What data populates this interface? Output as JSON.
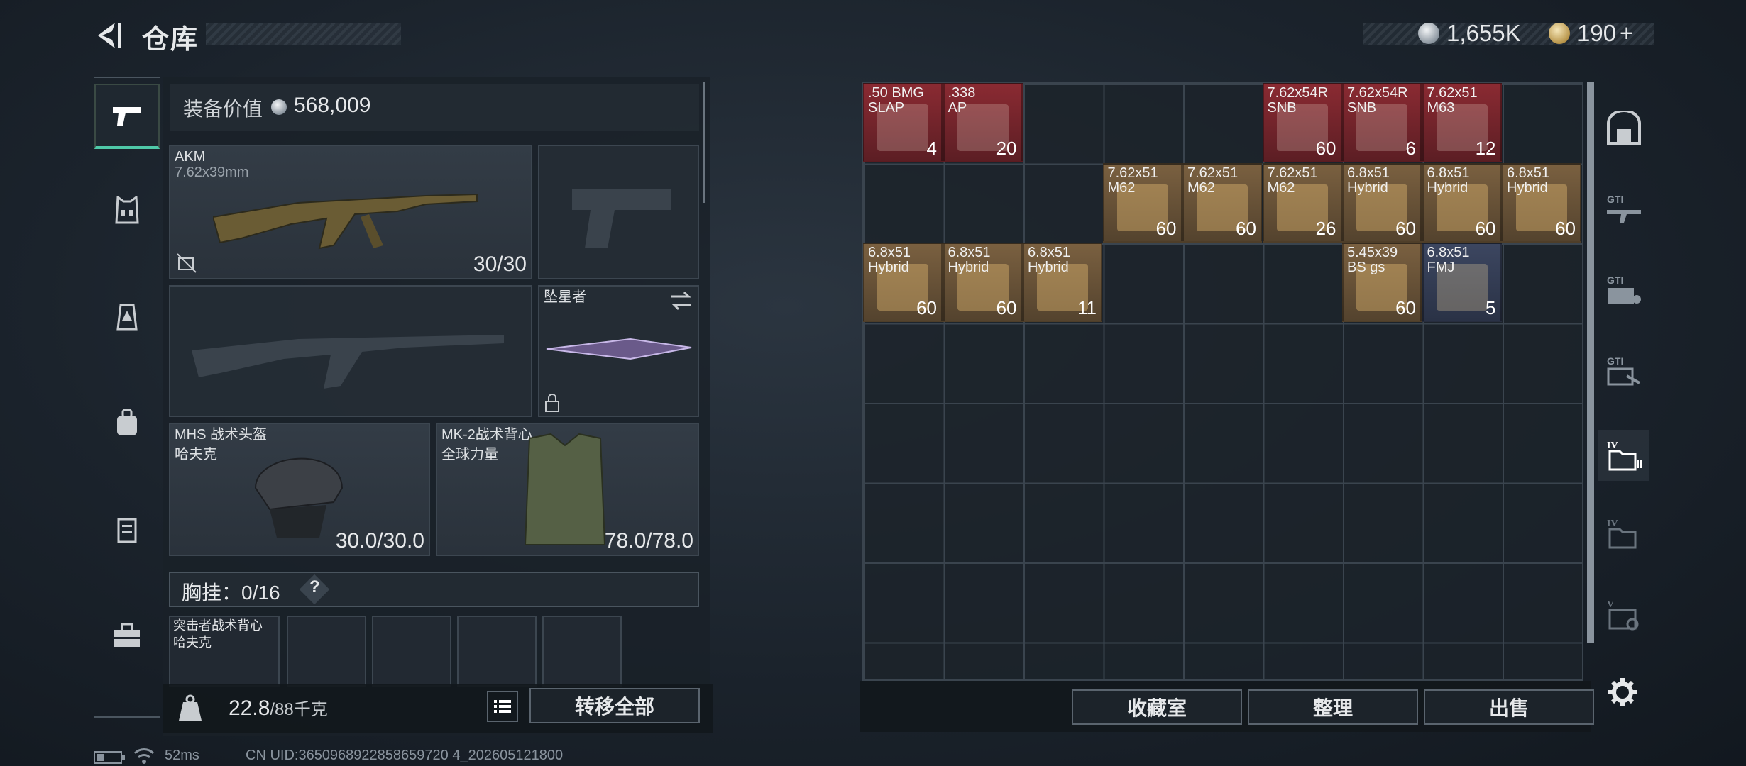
{
  "header": {
    "title": "仓库",
    "currency_silver": "1,655K",
    "currency_gold": "190",
    "gold_plus": "+"
  },
  "equipment": {
    "value_label": "装备价值",
    "value": "568,009",
    "primary": {
      "name": "AKM",
      "caliber": "7.62x39mm",
      "ammo": "30/30"
    },
    "melee": {
      "name": "坠星者"
    },
    "helmet": {
      "name": "MHS 战术头盔",
      "brand": "哈夫克",
      "durability": "30.0/30.0"
    },
    "armor": {
      "name": "MK-2战术背心",
      "brand": "全球力量",
      "durability": "78.0/78.0"
    },
    "chest_rig": {
      "label": "胸挂：",
      "capacity": "0/16",
      "help": "?"
    },
    "backpack_preview": {
      "name": "突击者战术背心",
      "brand": "哈夫克"
    }
  },
  "footer_left": {
    "weight": "22.8",
    "weight_max": "/88千克",
    "transfer_all": "转移全部"
  },
  "stash": {
    "items": [
      {
        "l1": ".50 BMG",
        "l2": "SLAP",
        "q": "4",
        "color": "red"
      },
      {
        "l1": ".338",
        "l2": "AP",
        "q": "20",
        "color": "red"
      },
      {
        "l1": "7.62x54R",
        "l2": "SNB",
        "q": "60",
        "color": "red"
      },
      {
        "l1": "7.62x54R",
        "l2": "SNB",
        "q": "6",
        "color": "red"
      },
      {
        "l1": "7.62x51",
        "l2": "M63",
        "q": "12",
        "color": "red"
      },
      {
        "l1": "7.62x51",
        "l2": "M62",
        "q": "60",
        "color": "brown"
      },
      {
        "l1": "7.62x51",
        "l2": "M62",
        "q": "60",
        "color": "brown"
      },
      {
        "l1": "7.62x51",
        "l2": "M62",
        "q": "26",
        "color": "brown"
      },
      {
        "l1": "6.8x51",
        "l2": "Hybrid",
        "q": "60",
        "color": "brown"
      },
      {
        "l1": "6.8x51",
        "l2": "Hybrid",
        "q": "60",
        "color": "brown"
      },
      {
        "l1": "6.8x51",
        "l2": "Hybrid",
        "q": "60",
        "color": "brown"
      },
      {
        "l1": "6.8x51",
        "l2": "Hybrid",
        "q": "60",
        "color": "brown"
      },
      {
        "l1": "6.8x51",
        "l2": "Hybrid",
        "q": "60",
        "color": "brown"
      },
      {
        "l1": "6.8x51",
        "l2": "Hybrid",
        "q": "11",
        "color": "brown"
      },
      {
        "l1": "5.45x39",
        "l2": "BS gs",
        "q": "60",
        "color": "brown"
      },
      {
        "l1": "6.8x51",
        "l2": "FMJ",
        "q": "5",
        "color": "navy"
      }
    ]
  },
  "footer_right": {
    "vault": "收藏室",
    "sort": "整理",
    "sell": "出售"
  },
  "status_bar": {
    "ping": "52ms",
    "uid": "CN UID:3650968922858659720 4_202605121800"
  },
  "colors": {
    "accent": "#4fc9a8",
    "red_item": "#6e2a30",
    "brown_item": "#5e4a30",
    "navy_item": "#323a52"
  }
}
